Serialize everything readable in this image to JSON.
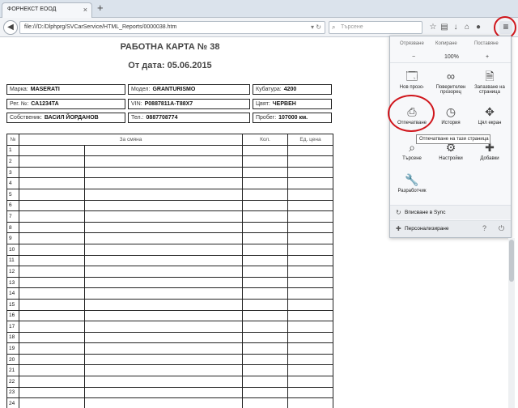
{
  "tab": {
    "title": "ФОРНЕКСТ ЕООД"
  },
  "navbar": {
    "url": "file:///D:/Dlphprg/SVCarService/HTML_Reports/0000038.htm",
    "search_placeholder": "Търсене"
  },
  "doc": {
    "title": "РАБОТНА КАРТА № 38",
    "date": "От дата: 05.06.2015",
    "info": [
      {
        "label": "Марка:",
        "value": "MASERATI"
      },
      {
        "label": "Модел:",
        "value": "GRANTURISMO"
      },
      {
        "label": "Кубатура:",
        "value": "4200"
      },
      {
        "label": "Рег. №:",
        "value": "СА1234ТА"
      },
      {
        "label": "VIN:",
        "value": "P0887811A-T88X7"
      },
      {
        "label": "Цвят:",
        "value": "ЧЕРВЕН"
      },
      {
        "label": "Собственик:",
        "value": "ВАСИЛ ЙОРДАНОВ"
      },
      {
        "label": "Тел.:",
        "value": "0887708774"
      },
      {
        "label": "Пробег:",
        "value": "107000 км."
      }
    ],
    "table": {
      "headers": [
        "№",
        "За смяна",
        "Кол.",
        "Ед. цена"
      ],
      "rows": [
        "1",
        "2",
        "3",
        "4",
        "5",
        "6",
        "7",
        "8",
        "9",
        "10",
        "11",
        "12",
        "13",
        "14",
        "15",
        "16",
        "17",
        "18",
        "19",
        "20",
        "21",
        "22",
        "23",
        "24"
      ]
    }
  },
  "menu": {
    "edit": {
      "cut": "Отрязване",
      "copy": "Копиране",
      "paste": "Поставяне"
    },
    "zoom": {
      "minus": "−",
      "value": "100%",
      "plus": "+"
    },
    "items": [
      {
        "icon": "new-window-icon",
        "glyph": "🗔",
        "label": "Нов прозо-"
      },
      {
        "icon": "private-window-icon",
        "glyph": "∞",
        "label": "Поверителен прозорец"
      },
      {
        "icon": "save-page-icon",
        "glyph": "🗎",
        "label": "Запазване на страница"
      },
      {
        "icon": "print-icon",
        "glyph": "⎙",
        "label": "Отпечатване"
      },
      {
        "icon": "history-icon",
        "glyph": "◷",
        "label": "История"
      },
      {
        "icon": "fullscreen-icon",
        "glyph": "✥",
        "label": "Цял екран"
      },
      {
        "icon": "find-icon",
        "glyph": "⌕",
        "label": "Търсене"
      },
      {
        "icon": "settings-icon",
        "glyph": "⚙",
        "label": "Настройки"
      },
      {
        "icon": "addons-icon",
        "glyph": "✚",
        "label": "Добавки"
      },
      {
        "icon": "developer-icon",
        "glyph": "🔧",
        "label": "Разработчик"
      }
    ],
    "sync": "Вписване в Sync",
    "customize": "Персонализиране",
    "tooltip": "Отпечатване на тази страница"
  }
}
